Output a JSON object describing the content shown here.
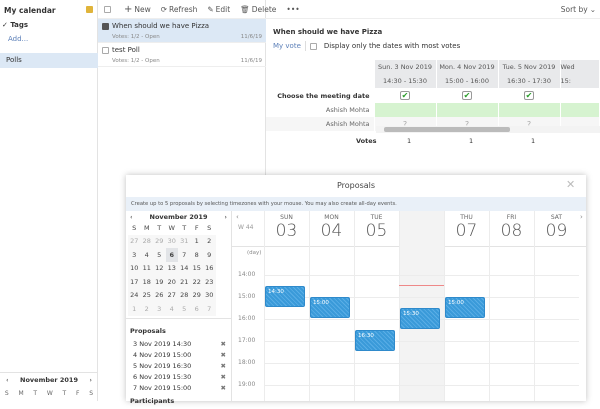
{
  "sidebar": {
    "calendar": "My calendar",
    "calendar_color": "#e0b43a",
    "tags": "Tags",
    "add": "Add...",
    "polls": "Polls",
    "mini": {
      "month": "November",
      "year": "2019",
      "weekdays": [
        "S",
        "M",
        "T",
        "W",
        "T",
        "F",
        "S"
      ]
    }
  },
  "toolbar": {
    "new": "New",
    "refresh": "Refresh",
    "edit": "Edit",
    "delete": "Delete",
    "more": "•••",
    "sort": "Sort by"
  },
  "list": [
    {
      "title": "When should we have Pizza",
      "meta": "Votes: 1/2 - Open",
      "date": "11/6/19",
      "checked": true
    },
    {
      "title": "test Poll",
      "meta": "Votes: 1/2 - Open",
      "date": "11/6/19",
      "checked": false
    }
  ],
  "detail": {
    "title": "When should we have Pizza",
    "my_vote": "My vote",
    "only_most": "Display only the dates with most votes",
    "dates": [
      "Sun. 3 Nov 2019",
      "Mon. 4 Nov 2019",
      "Tue. 5 Nov 2019",
      "Wed"
    ],
    "times": [
      "14:30 - 15:30",
      "15:00 - 16:00",
      "16:30 - 17:30",
      "15:"
    ],
    "choose": "Choose the meeting date",
    "row1": "Ashish Mohta",
    "row2": "Ashish Mohta",
    "unknown": "?",
    "votes_label": "Votes",
    "votes": [
      "1",
      "1",
      "1"
    ]
  },
  "modal": {
    "title": "Proposals",
    "hint": "Create up to 5 proposals by selecting timezones with your mouse. You may also create all-day events.",
    "month": "November",
    "year": "2019",
    "weekdays": [
      "S",
      "M",
      "T",
      "W",
      "T",
      "F",
      "S"
    ],
    "weeks": [
      [
        "27",
        "28",
        "29",
        "30",
        "31",
        "1",
        "2"
      ],
      [
        "3",
        "4",
        "5",
        "6",
        "7",
        "8",
        "9"
      ],
      [
        "10",
        "11",
        "12",
        "13",
        "14",
        "15",
        "16"
      ],
      [
        "17",
        "18",
        "19",
        "20",
        "21",
        "22",
        "23"
      ],
      [
        "24",
        "25",
        "26",
        "27",
        "28",
        "29",
        "30"
      ],
      [
        "1",
        "2",
        "3",
        "4",
        "5",
        "6",
        "7"
      ]
    ],
    "selected_day": "6",
    "proposals_label": "Proposals",
    "proposals": [
      "3 Nov 2019 14:30",
      "4 Nov 2019 15:00",
      "5 Nov 2019 16:30",
      "6 Nov 2019 15:30",
      "7 Nov 2019 15:00"
    ],
    "participants_label": "Participants",
    "week": "W 44",
    "allday": "(day)",
    "days": [
      {
        "n": "SUN",
        "d": "03"
      },
      {
        "n": "MON",
        "d": "04"
      },
      {
        "n": "TUE",
        "d": "05"
      },
      {
        "n": "WED",
        "d": "06",
        "today": true
      },
      {
        "n": "THU",
        "d": "07"
      },
      {
        "n": "FRI",
        "d": "08"
      },
      {
        "n": "SAT",
        "d": "09"
      }
    ],
    "hours": [
      "14:00",
      "15:00",
      "16:00",
      "17:00",
      "18:00",
      "19:00"
    ],
    "events": [
      {
        "day": 0,
        "start": "14:30"
      },
      {
        "day": 1,
        "start": "15:00"
      },
      {
        "day": 2,
        "start": "16:30"
      },
      {
        "day": 3,
        "start": "15:30"
      },
      {
        "day": 4,
        "start": "15:00"
      }
    ],
    "accent": "#3a9ad9"
  }
}
